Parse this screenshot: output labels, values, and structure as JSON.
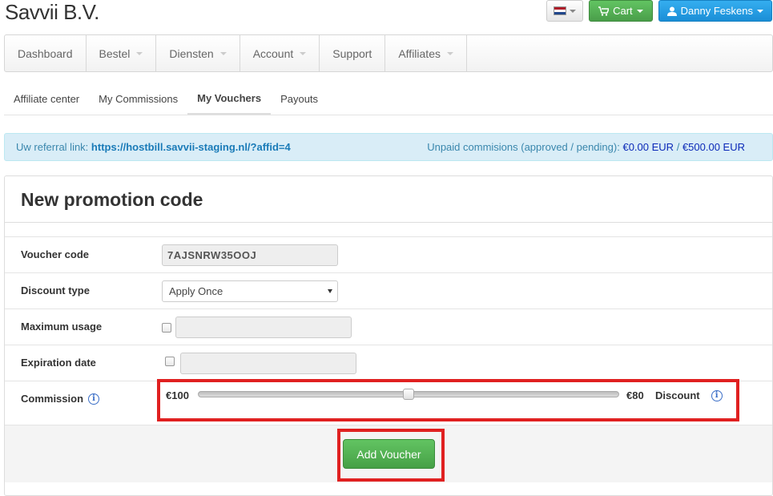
{
  "brand": "Savvii B.V.",
  "header": {
    "cart_label": "Cart",
    "user_label": "Danny Feskens",
    "flag_colors": [
      "#ae1c28",
      "#ffffff",
      "#21468b"
    ]
  },
  "mainnav": {
    "items": [
      {
        "label": "Dashboard",
        "dropdown": false
      },
      {
        "label": "Bestel",
        "dropdown": true
      },
      {
        "label": "Diensten",
        "dropdown": true
      },
      {
        "label": "Account",
        "dropdown": true
      },
      {
        "label": "Support",
        "dropdown": false
      },
      {
        "label": "Affiliates",
        "dropdown": true
      }
    ]
  },
  "subnav": {
    "tabs": [
      {
        "label": "Affiliate center"
      },
      {
        "label": "My Commissions"
      },
      {
        "label": "My Vouchers",
        "active": true
      },
      {
        "label": "Payouts"
      }
    ]
  },
  "alert": {
    "referral_prefix": "Uw referral link:",
    "referral_link": "https://hostbill.savvii-staging.nl/?affid=4",
    "unpaid_prefix": "Unpaid commisions (approved / pending):",
    "approved": "€0.00 EUR",
    "separator": "/",
    "pending": "€500.00 EUR"
  },
  "panel": {
    "title": "New promotion code",
    "voucher_code_label": "Voucher code",
    "voucher_code_value": "7AJSNRW35OOJ",
    "discount_type_label": "Discount type",
    "discount_type_value": "Apply Once",
    "maximum_usage_label": "Maximum usage",
    "expiration_date_label": "Expiration date",
    "commission_label": "Commission",
    "commission_value": "€100",
    "discount_value": "€80",
    "discount_label": "Discount",
    "slider_position": 0.5,
    "info_glyph": "i",
    "add_button_label": "Add Voucher"
  },
  "colors": {
    "highlight": "#e02020",
    "success": "#4a9e4a",
    "primary": "#1a8ed6"
  }
}
